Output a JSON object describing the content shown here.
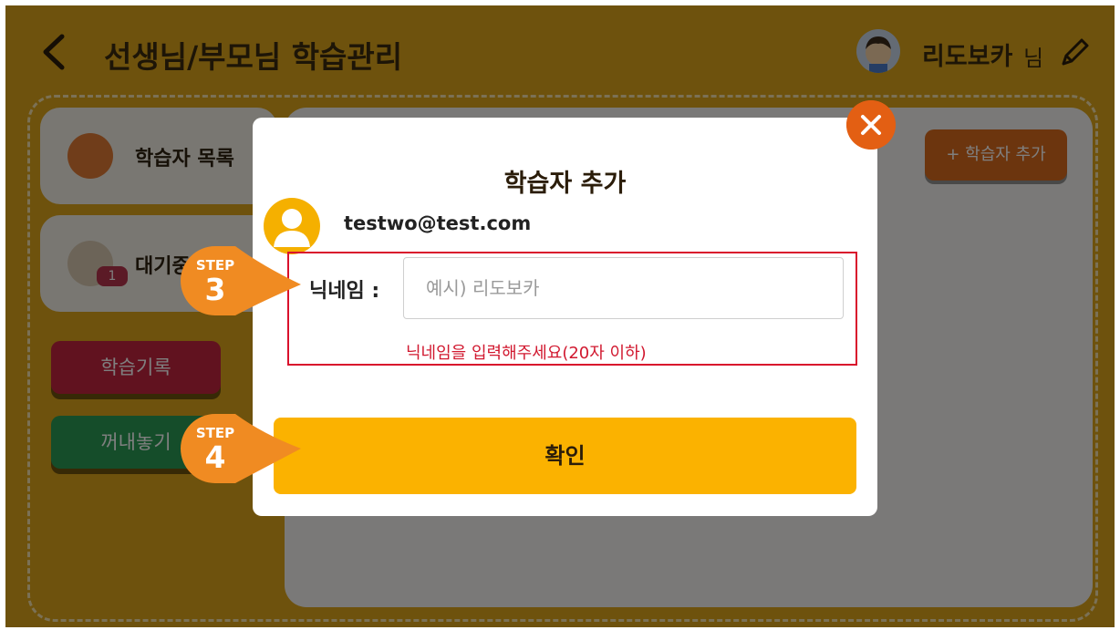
{
  "header": {
    "title": "선생님/부모님 학습관리",
    "user_name": "리도보카",
    "user_suffix": "님"
  },
  "panels": {
    "learner_list_label": "학습자 목록",
    "waiting_label": "대기중",
    "waiting_count": "1",
    "record_button": "학습기록",
    "out_button": "꺼내놓기",
    "add_learner_button": "+ 학습자 추가"
  },
  "modal": {
    "title": "학습자 추가",
    "email": "testwo@test.com",
    "nickname_label": "닉네임 :",
    "nickname_value": "",
    "nickname_placeholder": "예시) 리도보카",
    "hint": "닉네임을 입력해주세요(20자 이하)",
    "confirm_label": "확인"
  },
  "steps": [
    {
      "word": "STEP",
      "number": "3"
    },
    {
      "word": "STEP",
      "number": "4"
    }
  ],
  "colors": {
    "background": "#dda51a",
    "accent": "#fbb200",
    "close": "#e35f13",
    "error": "#d1182f"
  }
}
